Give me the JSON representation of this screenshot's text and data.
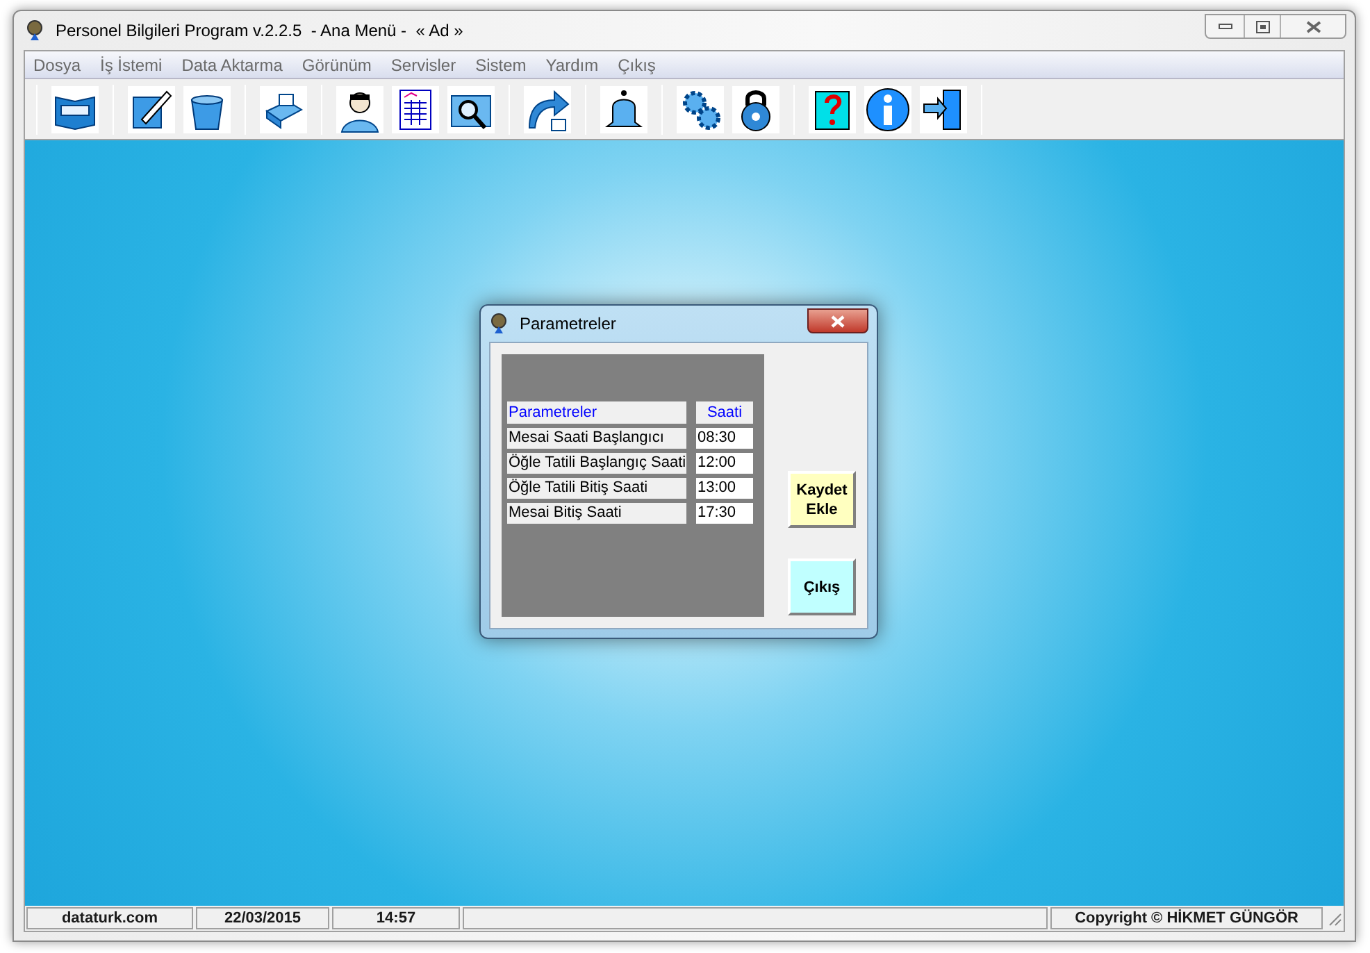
{
  "window": {
    "title": "Personel Bilgileri Program v.2.2.5  - Ana Menü -  « Ad »"
  },
  "menu": [
    "Dosya",
    "İş İstemi",
    "Data Aktarma",
    "Görünüm",
    "Servisler",
    "Sistem",
    "Yardım",
    "Çıkış"
  ],
  "dialog": {
    "title": "Parametreler",
    "columns": [
      "Parametreler",
      "Saati"
    ],
    "rows": [
      {
        "label": "Mesai Saati Başlangıcı",
        "value": "08:30"
      },
      {
        "label": "Öğle Tatili Başlangıç Saati",
        "value": "12:00"
      },
      {
        "label": "Öğle Tatili Bitiş Saati",
        "value": "13:00"
      },
      {
        "label": "Mesai Bitiş Saati",
        "value": "17:30"
      }
    ],
    "buttons": [
      {
        "kind": "save",
        "lines": [
          "Kaydet",
          "Ekle"
        ]
      },
      {
        "kind": "exit",
        "lines": [
          "Çıkış"
        ]
      }
    ]
  },
  "status_bar": {
    "website": "dataturk.com",
    "date": "22/03/2015",
    "time": "14:57",
    "copyright": "Copyright © HİKMET GÜNGÖR"
  }
}
